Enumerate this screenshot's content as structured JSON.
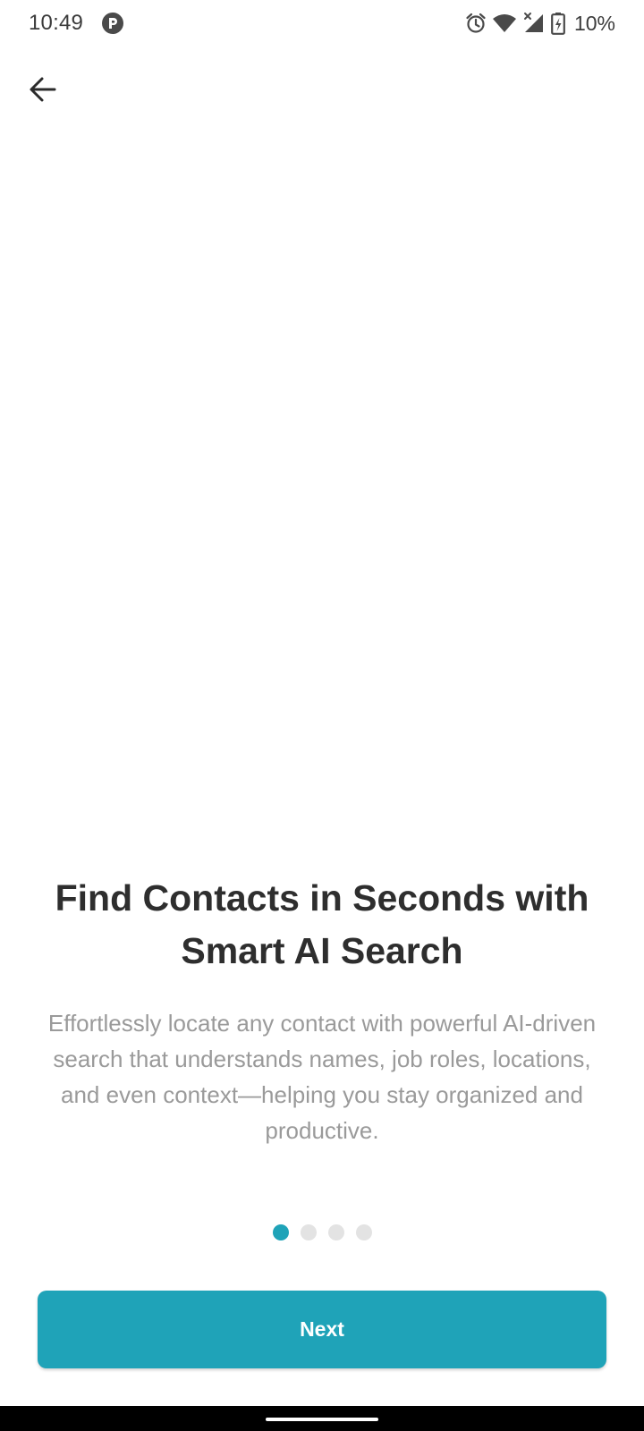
{
  "status_bar": {
    "time": "10:49",
    "battery_percent": "10%",
    "icons": [
      "app-notification-icon",
      "alarm-icon",
      "wifi-icon",
      "cell-signal-icon",
      "battery-charging-icon"
    ]
  },
  "header": {
    "back_icon": "arrow-left-icon"
  },
  "onboarding": {
    "title": "Find Contacts in Seconds with Smart AI Search",
    "description": "Effortlessly locate any contact with powerful AI-driven search that understands names, job roles, locations, and even context—helping you stay organized and productive.",
    "page_count": 4,
    "current_page": 1,
    "next_label": "Next"
  },
  "colors": {
    "accent": "#1fa3b8",
    "inactive_dot": "#e3e3e3",
    "title_text": "#2e2e2e",
    "body_text": "#9a9a9a"
  }
}
